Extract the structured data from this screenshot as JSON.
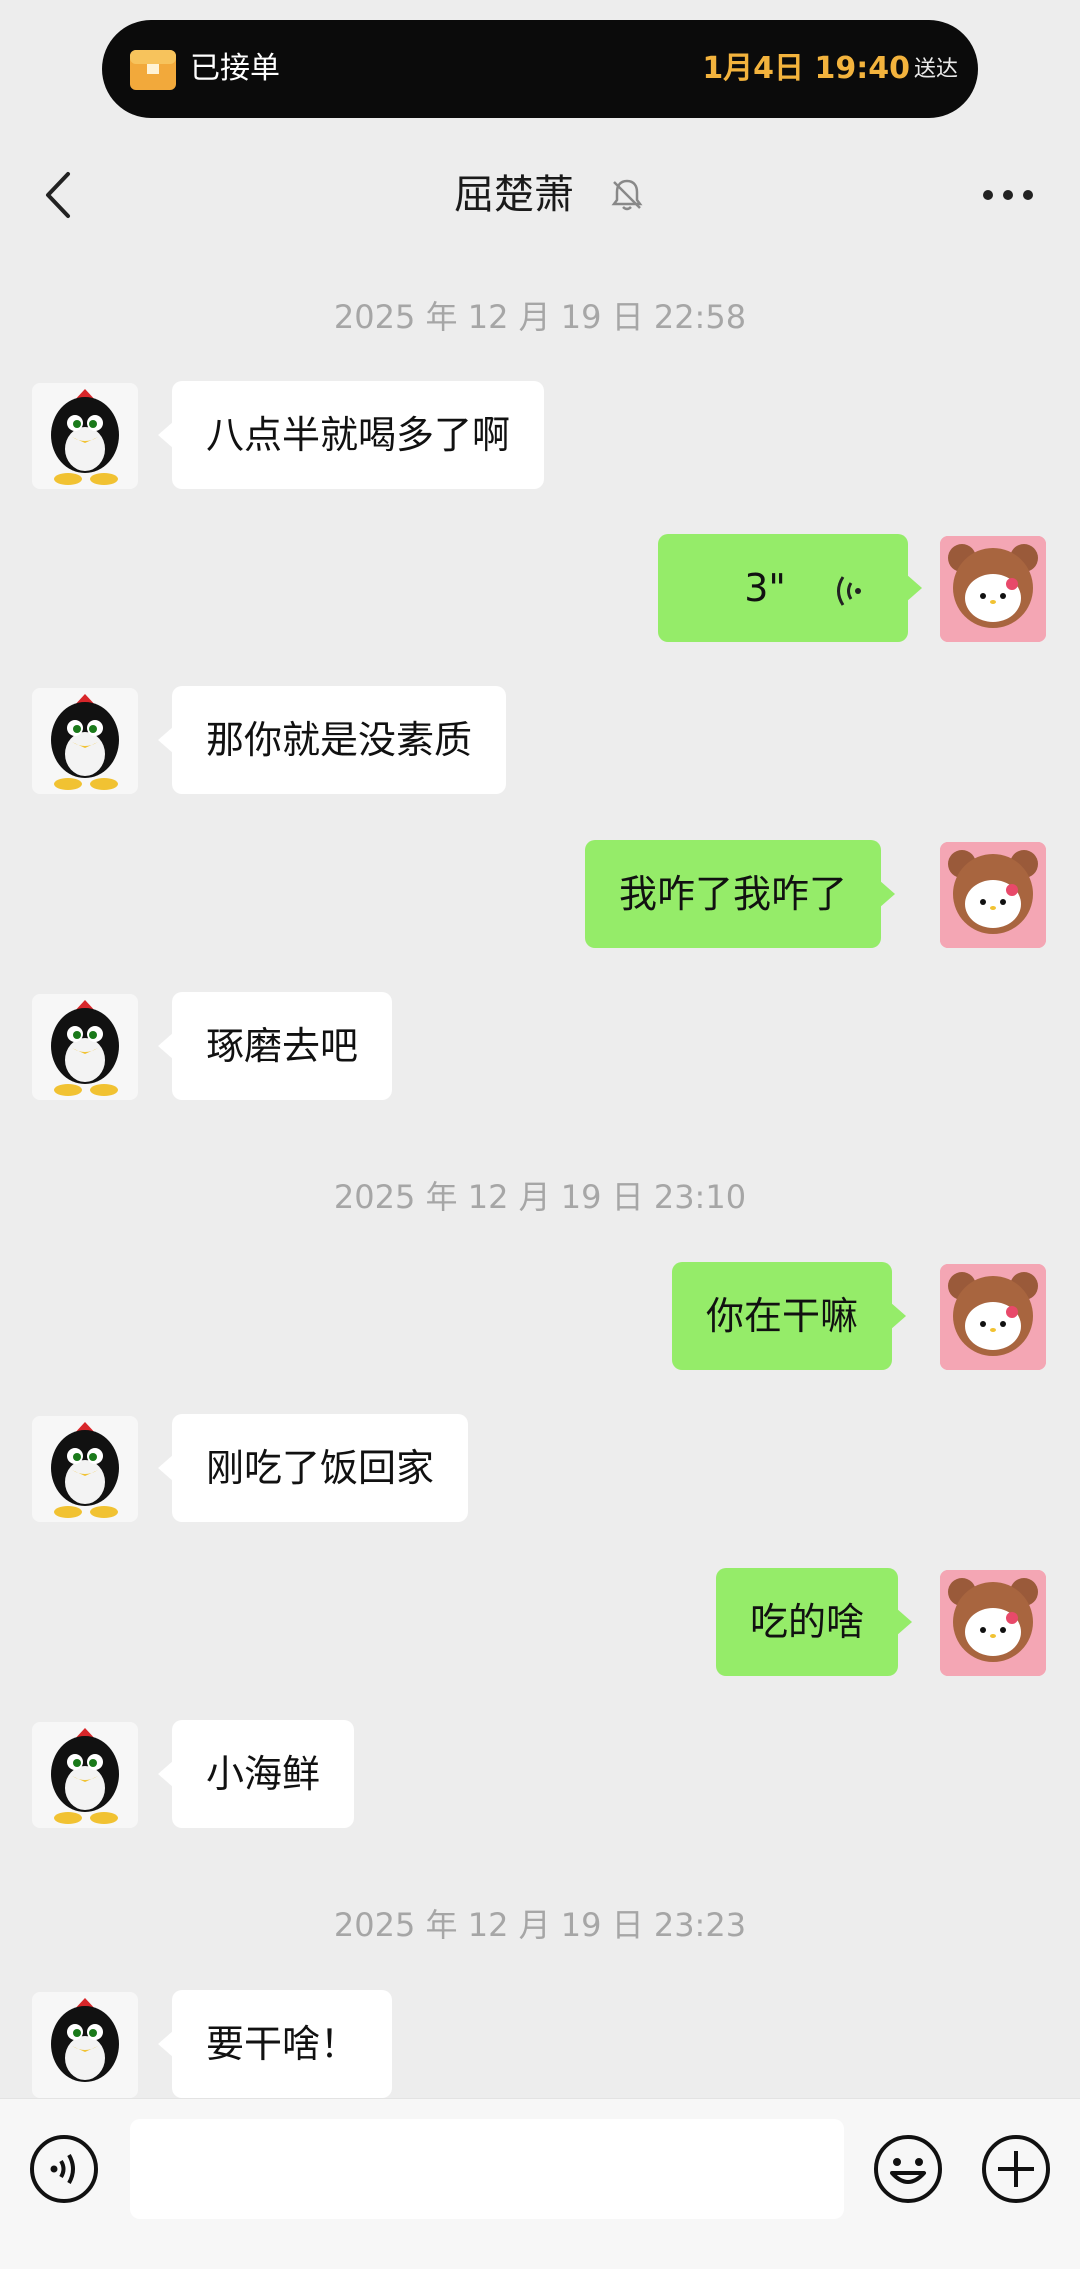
{
  "notification": {
    "status": "已接单",
    "date": "1月4日 19:40",
    "delivered": "送达"
  },
  "header": {
    "title": "屈楚萧"
  },
  "messages": [
    {
      "type": "time",
      "text": "2025 年 12 月 19 日 22:58"
    },
    {
      "type": "left",
      "text": "八点半就喝多了啊"
    },
    {
      "type": "voice-right",
      "duration": "3\""
    },
    {
      "type": "left",
      "text": "那你就是没素质"
    },
    {
      "type": "right",
      "text": "我咋了我咋了"
    },
    {
      "type": "left",
      "text": "琢磨去吧"
    },
    {
      "type": "time",
      "text": "2025 年 12 月 19 日 23:10"
    },
    {
      "type": "right",
      "text": "你在干嘛"
    },
    {
      "type": "left",
      "text": "刚吃了饭回家"
    },
    {
      "type": "right",
      "text": "吃的啥"
    },
    {
      "type": "left",
      "text": "小海鲜"
    },
    {
      "type": "time",
      "text": "2025 年 12 月 19 日 23:23"
    },
    {
      "type": "left",
      "text": "要干啥！"
    }
  ],
  "input": {
    "value": ""
  },
  "colors": {
    "sent_bubble": "#95ec69",
    "received_bubble": "#ffffff",
    "background": "#ededed",
    "accent_date": "#f3b33d"
  },
  "icons": [
    "package-icon",
    "back-arrow-icon",
    "mute-bell-icon",
    "more-icon",
    "voice-icon",
    "emoji-icon",
    "plus-icon"
  ]
}
